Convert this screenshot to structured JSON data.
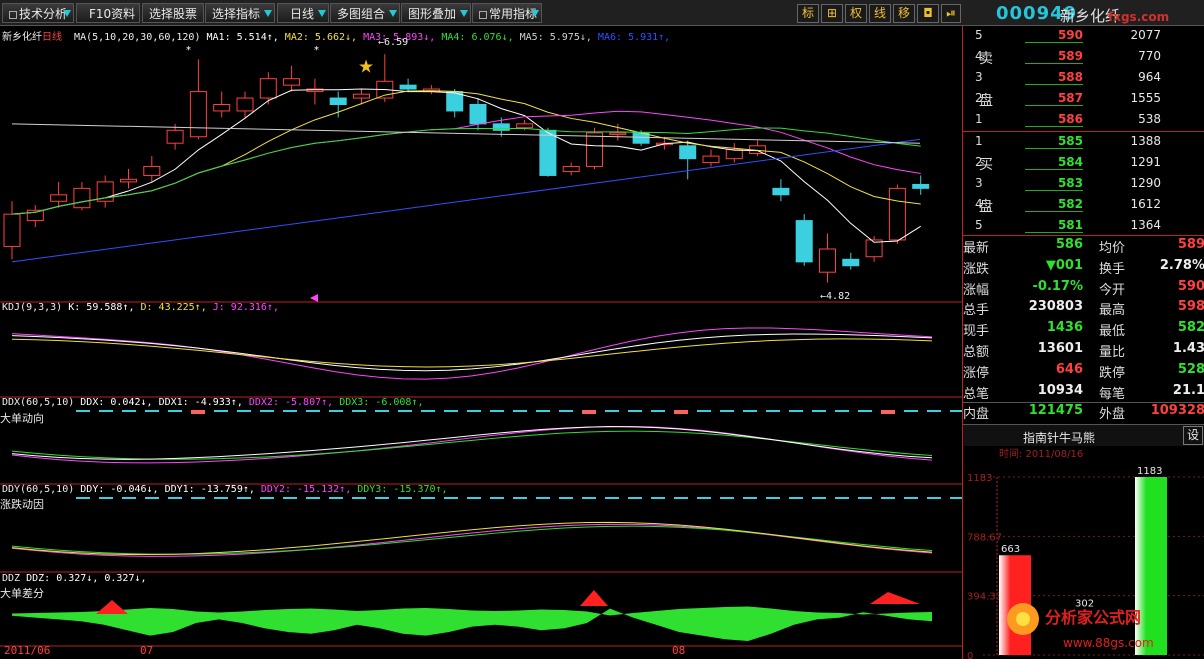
{
  "toolbar": {
    "buttons": [
      "技术分析",
      "F10资料",
      "选择股票",
      "选择指标",
      "日线",
      "多图组合",
      "图形叠加",
      "常用指标"
    ],
    "tools": [
      "标",
      "⊞",
      "权",
      "线",
      "移",
      "◘",
      "⏯"
    ]
  },
  "stock": {
    "code": "000949",
    "name": "新乡化纤",
    "period": "日线",
    "watermark_top": "fxgs.com"
  },
  "main_chart": {
    "title": "新乡化纤",
    "ma_label": "MA(5,10,20,30,60,120)",
    "ma": [
      {
        "name": "MA1",
        "value": "5.514",
        "dir": "↑",
        "color": "#ffffff"
      },
      {
        "name": "MA2",
        "value": "5.662",
        "dir": "↓",
        "color": "#f0e040"
      },
      {
        "name": "MA3",
        "value": "5.893",
        "dir": "↓",
        "color": "#ff44ff"
      },
      {
        "name": "MA4",
        "value": "6.076",
        "dir": "↓",
        "color": "#30e030"
      },
      {
        "name": "MA5",
        "value": "5.975",
        "dir": "↓",
        "color": "#d0d0d0"
      },
      {
        "name": "MA6",
        "value": "5.931",
        "dir": "↑",
        "color": "#3050ff"
      }
    ],
    "high_marker": "6.59",
    "low_marker": "4.82"
  },
  "kdj": {
    "label": "KDJ(9,3,3)",
    "values": [
      {
        "name": "K",
        "value": "59.588",
        "dir": "↑",
        "color": "#ffffff"
      },
      {
        "name": "D",
        "value": "43.225",
        "dir": "↑",
        "color": "#f0e040"
      },
      {
        "name": "J",
        "value": "92.316",
        "dir": "↑",
        "color": "#ff44ff"
      }
    ]
  },
  "ddx": {
    "label": "DDX(60,5,10)",
    "sub": "大单动向",
    "values": [
      {
        "name": "DDX",
        "value": "0.042",
        "dir": "↓",
        "color": "#ffffff"
      },
      {
        "name": "DDX1",
        "value": "-4.933",
        "dir": "↑",
        "color": "#ffffff"
      },
      {
        "name": "DDX2",
        "value": "-5.807",
        "dir": "↑",
        "color": "#ff44ff"
      },
      {
        "name": "DDX3",
        "value": "-6.008",
        "dir": "↑",
        "color": "#30e030"
      }
    ]
  },
  "ddy": {
    "label": "DDY(60,5,10)",
    "sub": "涨跌动因",
    "values": [
      {
        "name": "DDY",
        "value": "-0.046",
        "dir": "↓",
        "color": "#ffffff"
      },
      {
        "name": "DDY1",
        "value": "-13.759",
        "dir": "↑",
        "color": "#ffffff"
      },
      {
        "name": "DDY2",
        "value": "-15.132",
        "dir": "↑",
        "color": "#ff44ff"
      },
      {
        "name": "DDY3",
        "value": "-15.370",
        "dir": "↑",
        "color": "#30e030"
      }
    ]
  },
  "ddz": {
    "label": "DDZ",
    "sub": "大单差分",
    "values": [
      {
        "name": "DDZ",
        "value": "0.327",
        "dir": "↓",
        "color": "#ffffff"
      },
      {
        "name": "",
        "value": "0.327",
        "dir": "↓",
        "color": "#ffffff"
      }
    ]
  },
  "x_axis": [
    "2011/06",
    "07",
    "08"
  ],
  "order_book": {
    "sell_label": [
      "卖",
      "盘"
    ],
    "buy_label": [
      "买",
      "盘"
    ],
    "sell": [
      {
        "level": "5",
        "price": "590",
        "volume": "2077"
      },
      {
        "level": "4",
        "price": "589",
        "volume": "770"
      },
      {
        "level": "3",
        "price": "588",
        "volume": "964"
      },
      {
        "level": "2",
        "price": "587",
        "volume": "1555"
      },
      {
        "level": "1",
        "price": "586",
        "volume": "538"
      }
    ],
    "buy": [
      {
        "level": "1",
        "price": "585",
        "volume": "1388"
      },
      {
        "level": "2",
        "price": "584",
        "volume": "1291"
      },
      {
        "level": "3",
        "price": "583",
        "volume": "1290"
      },
      {
        "level": "4",
        "price": "582",
        "volume": "1612"
      },
      {
        "level": "5",
        "price": "581",
        "volume": "1364"
      }
    ]
  },
  "quote": [
    {
      "l1": "最新",
      "v1": "586",
      "c1": "green",
      "l2": "均价",
      "v2": "589",
      "c2": "red"
    },
    {
      "l1": "涨跌",
      "v1": "▼001",
      "c1": "green",
      "l2": "换手",
      "v2": "2.78%",
      "c2": "white"
    },
    {
      "l1": "涨幅",
      "v1": "-0.17%",
      "c1": "green",
      "l2": "今开",
      "v2": "590",
      "c2": "red"
    },
    {
      "l1": "总手",
      "v1": "230803",
      "c1": "white",
      "l2": "最高",
      "v2": "598",
      "c2": "red"
    },
    {
      "l1": "现手",
      "v1": "1436",
      "c1": "green",
      "l2": "最低",
      "v2": "582",
      "c2": "green"
    },
    {
      "l1": "总额",
      "v1": "13601",
      "c1": "white",
      "l2": "量比",
      "v2": "1.43",
      "c2": "white"
    },
    {
      "l1": "涨停",
      "v1": "646",
      "c1": "red",
      "l2": "跌停",
      "v2": "528",
      "c2": "green"
    },
    {
      "l1": "总笔",
      "v1": "10934",
      "c1": "white",
      "l2": "每笔",
      "v2": "21.1",
      "c2": "white"
    },
    {
      "l1": "内盘",
      "v1": "121475",
      "c1": "green",
      "l2": "外盘",
      "v2": "109328",
      "c2": "red"
    }
  ],
  "indicator_tab": {
    "title": "指南针牛马熊",
    "settings": "设"
  },
  "bar_panel": {
    "date": "时间: 2011/08/16",
    "y_ticks": [
      "1183",
      "788.67",
      "394.33",
      "0"
    ],
    "bars": [
      {
        "value": 663,
        "color": "#ff2020"
      },
      {
        "value": 302,
        "color": "#000000"
      },
      {
        "value": 1183,
        "color": "#20e020"
      }
    ],
    "ymax": 1183
  },
  "watermark": {
    "title": "分析家公式网",
    "url": "www.88gs.com"
  }
}
